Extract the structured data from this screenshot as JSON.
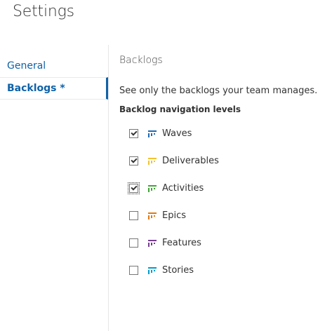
{
  "header": {
    "title": "Settings"
  },
  "nav": {
    "items": [
      {
        "label": "General"
      },
      {
        "label": "Backlogs *"
      }
    ]
  },
  "content": {
    "section_title": "Backlogs",
    "description": "See only the backlogs your team manages.",
    "levels_label": "Backlog navigation levels",
    "levels": [
      {
        "label": "Waves",
        "checked": true,
        "color": "#1e69b3"
      },
      {
        "label": "Deliverables",
        "checked": true,
        "color": "#f2c32f"
      },
      {
        "label": "Activities",
        "checked": true,
        "color": "#3fa535"
      },
      {
        "label": "Epics",
        "checked": false,
        "color": "#e07a13"
      },
      {
        "label": "Features",
        "checked": false,
        "color": "#773b93"
      },
      {
        "label": "Stories",
        "checked": false,
        "color": "#009ccc"
      }
    ]
  }
}
